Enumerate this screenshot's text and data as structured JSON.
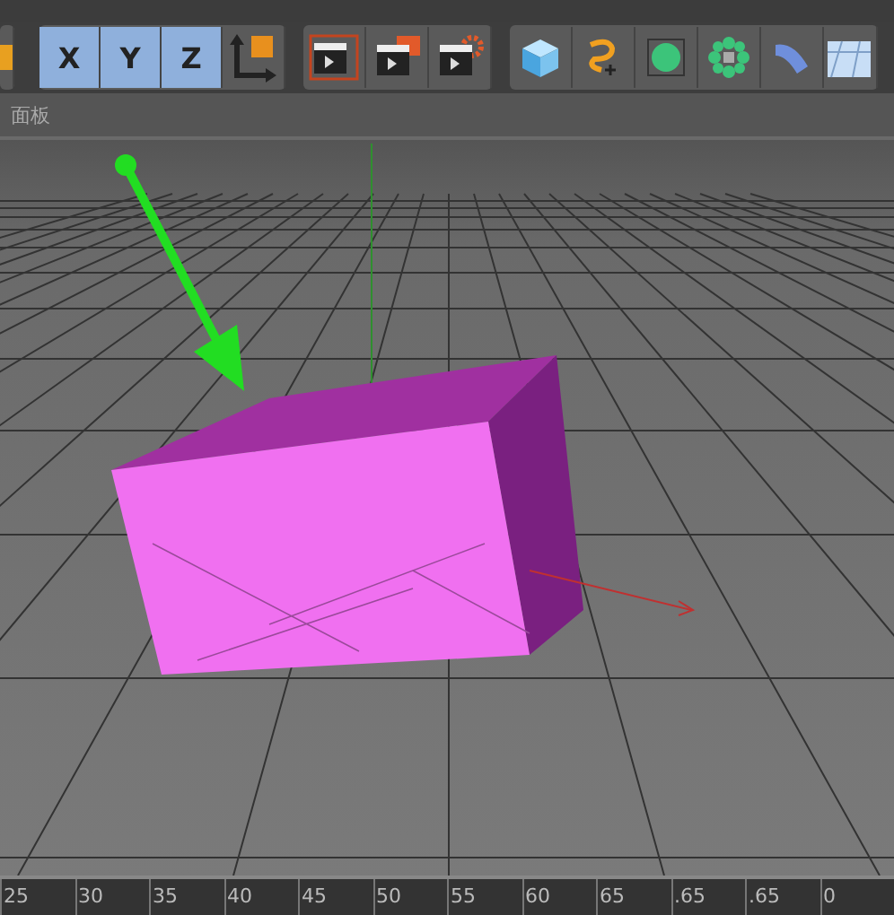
{
  "toolbar": {
    "axis_buttons": [
      {
        "label": "X",
        "selected": true
      },
      {
        "label": "Y",
        "selected": true
      },
      {
        "label": "Z",
        "selected": true
      }
    ]
  },
  "panel": {
    "title": "面板"
  },
  "timeline": {
    "ticks": [
      "25",
      "30",
      "35",
      "40",
      "45",
      "50",
      "55",
      "60",
      "65",
      ".65",
      ".65",
      "0"
    ]
  }
}
